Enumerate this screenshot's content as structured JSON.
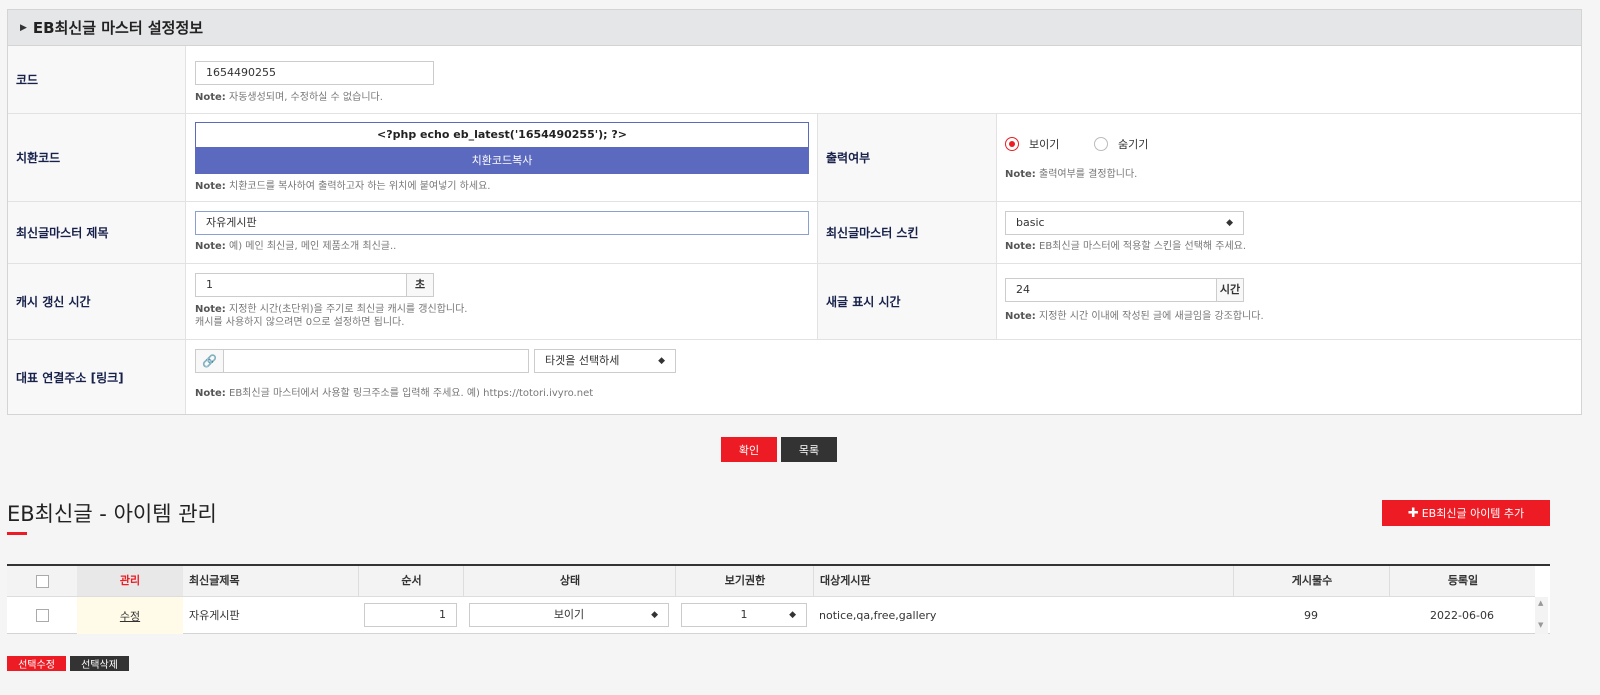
{
  "settings": {
    "title": "EB최신글 마스터 설정정보",
    "code": {
      "label": "코드",
      "value": "1654490255",
      "note_prefix": "Note:",
      "note": "자동생성되며, 수정하실 수 없습니다."
    },
    "replace": {
      "label": "치환코드",
      "code": "<?php echo eb_latest('1654490255'); ?>",
      "copy_button": "치환코드복사",
      "note_prefix": "Note:",
      "note": "치환코드를 복사하여 출력하고자 하는 위치에 붙여넣기 하세요."
    },
    "output": {
      "label": "출력여부",
      "option_show": "보이기",
      "option_hide": "숨기기",
      "note_prefix": "Note:",
      "note": "출력여부를 결정합니다."
    },
    "master_title": {
      "label": "최신글마스터 제목",
      "value": "자유게시판",
      "note_prefix": "Note:",
      "note": "예) 메인 최신글, 메인 제품소개 최신글.."
    },
    "skin": {
      "label": "최신글마스터 스킨",
      "value": "basic",
      "note_prefix": "Note:",
      "note": "EB최신글 마스터에 적용할 스킨을 선택해 주세요."
    },
    "cache": {
      "label": "캐시 갱신 시간",
      "value": "1",
      "unit": "초",
      "note_prefix": "Note:",
      "note": "지정한 시간(초단위)을 주기로 최신글 캐시를 갱신합니다.",
      "note2": "캐시를 사용하지 않으려면 0으로 설정하면 됩니다."
    },
    "newpost": {
      "label": "새글 표시 시간",
      "value": "24",
      "unit": "시간",
      "note_prefix": "Note:",
      "note": "지정한 시간 이내에 작성된 글에 새글임을 강조합니다."
    },
    "link": {
      "label": "대표 연결주소 [링크]",
      "value": "",
      "target_select": "타겟을 선택하세",
      "note_prefix": "Note:",
      "note": "EB최신글 마스터에서 사용할 링크주소를 입력해 주세요. 예) https://totori.ivyro.net"
    }
  },
  "actions": {
    "confirm": "확인",
    "list": "목록"
  },
  "items": {
    "title": "EB최신글 - 아이템 관리",
    "add_button": "EB최신글 아이템 추가",
    "headers": {
      "manage": "관리",
      "title": "최신글제목",
      "order": "순서",
      "status": "상태",
      "perm": "보기권한",
      "boards": "대상게시판",
      "count": "게시물수",
      "date": "등록일"
    },
    "rows": [
      {
        "edit": "수정",
        "title": "자유게시판",
        "order": "1",
        "status": "보이기",
        "perm": "1",
        "boards": "notice,qa,free,gallery",
        "count": "99",
        "date": "2022-06-06"
      }
    ],
    "bulk_edit": "선택수정",
    "bulk_delete": "선택삭제"
  },
  "colors": {
    "accent": "#ed1c24",
    "copy_btn": "#5b6abf",
    "dark": "#333333"
  }
}
